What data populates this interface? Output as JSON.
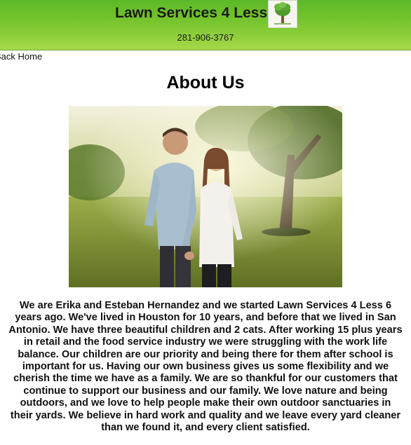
{
  "header": {
    "title": "Lawn Services 4 Less",
    "phone": "281-906-3767",
    "logo_icon": "tree-icon"
  },
  "nav": {
    "back_label": "Back Home"
  },
  "main": {
    "title": "About Us",
    "photo_icon": "couple-in-park-photo",
    "body": "We are Erika and Esteban Hernandez and we started Lawn Services 4 Less 6 years ago. We've lived in Houston for 10 years, and before that we lived in San Antonio. We have three beautiful children and 2 cats. After working 15 plus years in retail and the food service industry we were struggling with the work life balance. Our children are our priority and being there for them after school is important for us. Having our own business gives us some flexibility and we cherish the time we have as a family. We are so thankful for our customers that continue to support our business and our family. We love nature and being outdoors, and we love to help people make their own outdoor sanctuaries in their yards. We believe in hard work and quality and we leave every yard cleaner than we found it, and every client satisfied."
  },
  "colors": {
    "header_green": "#79c52f",
    "text": "#111111"
  }
}
